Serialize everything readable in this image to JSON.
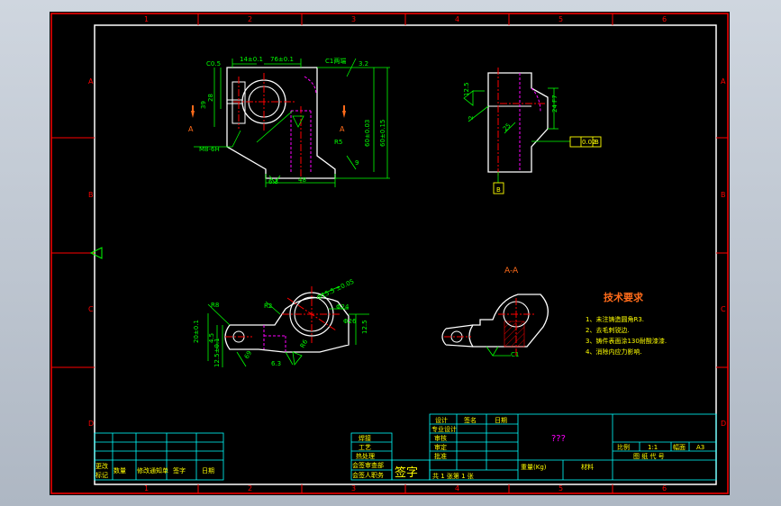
{
  "border": {
    "top_numbers": [
      "1",
      "2",
      "3",
      "4",
      "5",
      "6"
    ],
    "bottom_numbers": [
      "1",
      "2",
      "3",
      "4",
      "5",
      "6"
    ],
    "side_letters": [
      "A",
      "B",
      "C",
      "D"
    ]
  },
  "view_top_left": {
    "dims": [
      "C0.5",
      "14±0.1",
      "76±0.1",
      "C1两端",
      "3.2",
      "28",
      "39",
      "M8-6H",
      "A",
      "A",
      "R5",
      "60±0.03",
      "60±0.15",
      "9",
      "6.3",
      "48"
    ]
  },
  "view_side": {
    "dims": [
      "12.5",
      "2",
      "25",
      "24 F7",
      "0.02",
      "B",
      "B"
    ]
  },
  "view_bottom_left": {
    "dims": [
      "R8",
      "R2",
      "20±0.1",
      "4.5",
      "12.5±0.1",
      "69",
      "6.3",
      "R6",
      "Φ15.5 ±0.05",
      "Φ24",
      "Φ26",
      "12.5"
    ]
  },
  "view_section": {
    "title": "A-A",
    "dims": [
      "C1"
    ]
  },
  "tech": {
    "title": "技术要求",
    "items": [
      "1、未注铸造圆角R3.",
      "2、去毛刺锐边.",
      "3、铸件表面涂130耐酸漆漆.",
      "4、消除内应力影响."
    ]
  },
  "title_block": {
    "left_row1": "更改",
    "left_row2": "标记",
    "left_labels": [
      "数量",
      "修改通知单",
      "签字",
      "日期"
    ],
    "mid_labels": [
      "焊接",
      "工艺",
      "热处理",
      "会签审查部",
      "会签人职务"
    ],
    "signature": "签字",
    "header": [
      "设计",
      "签名",
      "日期"
    ],
    "roles": [
      "专业设计",
      "审核",
      "审定",
      "批准"
    ],
    "sheet_count": "共 1 张第 1 张",
    "title": "???",
    "weight_label": "重量(Kg)",
    "material_label": "材料",
    "scale_label": "比例",
    "scale_value": "1:1",
    "sheet_label": "幅面",
    "sheet_value": "A3",
    "drawing_no_label": "图 纸 代 号"
  },
  "colors": {
    "background": "#000000",
    "frame": "#ffffff",
    "border": "#ff0000",
    "outline": "#ffffff",
    "dimension": "#00ff00",
    "centerline": "#ff0000",
    "hidden": "#ff00ff",
    "hatch": "#ff0000",
    "text_yellow": "#ffff00",
    "text_orange": "#ff6b1a",
    "datum": "#ffff00"
  }
}
